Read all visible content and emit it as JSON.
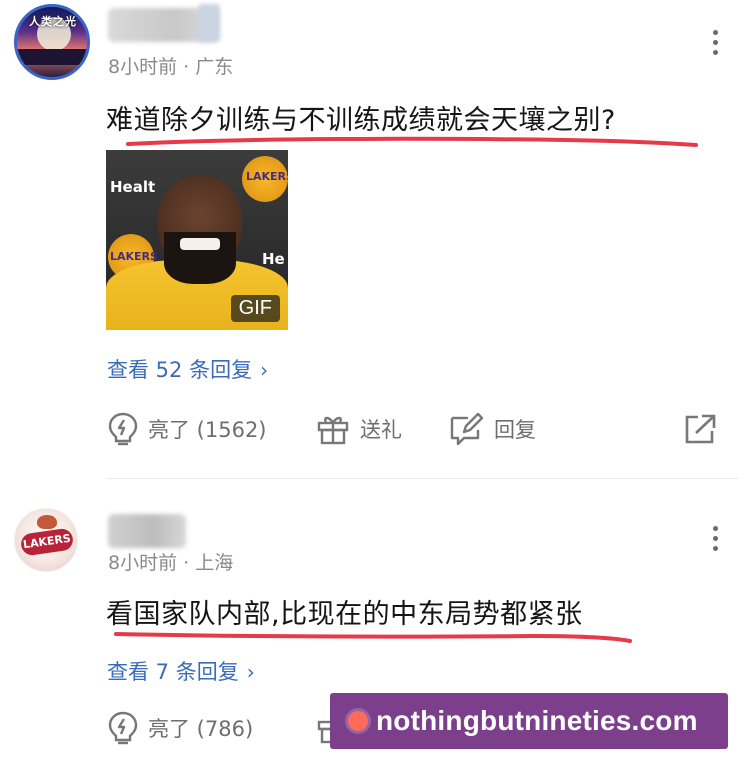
{
  "comments": [
    {
      "meta": "8小时前 · 广东",
      "avatar_caption": "人类之光",
      "text": "难道除夕训练与不训练成绩就会天壤之别?",
      "gif_label": "GIF",
      "thumb_sponsor_1": "Healt",
      "thumb_sponsor_2": "He",
      "thumb_team_1": "LAKERS",
      "thumb_team_2": "LAKERS",
      "replies": "查看 52 条回复",
      "actions": {
        "like": "亮了 (1562)",
        "gift": "送礼",
        "reply": "回复"
      }
    },
    {
      "meta": "8小时前 · 上海",
      "avatar_caption": "LAKERS",
      "text": "看国家队内部,比现在的中东局势都紧张",
      "replies": "查看 7 条回复",
      "actions": {
        "like": "亮了 (786)"
      }
    }
  ],
  "icons": {
    "more": "more-vertical-icon",
    "like": "lightbulb-icon",
    "gift": "gift-icon",
    "reply": "edit-reply-icon",
    "share": "share-icon",
    "chevron": "chevron-right-icon"
  },
  "colors": {
    "link": "#3a6bb8",
    "underline": "#e53a4a",
    "meta": "#8a8a8a",
    "watermark_bg": "#7b3f8c"
  },
  "watermark": {
    "text": "nothingbutnineties.com"
  }
}
